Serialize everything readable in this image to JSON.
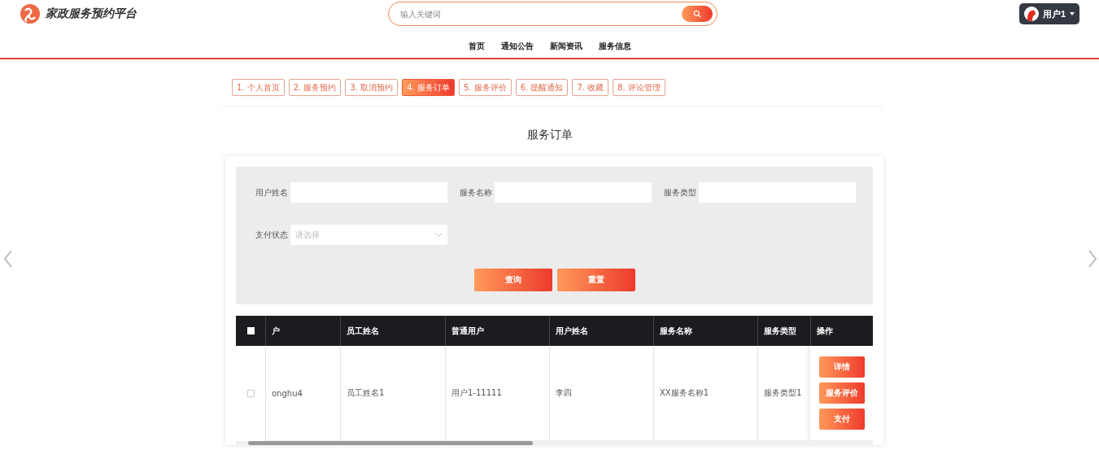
{
  "header": {
    "site_title": "家政服务预约平台",
    "search": {
      "placeholder": "输入关键词"
    },
    "user": {
      "name": "用户1"
    }
  },
  "nav": [
    {
      "label": "首页"
    },
    {
      "label": "通知公告"
    },
    {
      "label": "新闻资讯"
    },
    {
      "label": "服务信息"
    }
  ],
  "center_tabs": [
    {
      "label": "1. 个人首页",
      "selected": false
    },
    {
      "label": "2. 服务预约",
      "selected": false
    },
    {
      "label": "3. 取消预约",
      "selected": false
    },
    {
      "label": "4. 服务订单",
      "selected": true
    },
    {
      "label": "5. 服务评价",
      "selected": false
    },
    {
      "label": "6. 提醒通知",
      "selected": false
    },
    {
      "label": "7. 收藏",
      "selected": false
    },
    {
      "label": "8. 评论管理",
      "selected": false
    }
  ],
  "page_title": "服务订单",
  "filters": [
    {
      "label": "用户姓名",
      "kind": "text"
    },
    {
      "label": "服务名称",
      "kind": "text"
    },
    {
      "label": "服务类型",
      "kind": "text"
    },
    {
      "label": "支付状态",
      "kind": "select",
      "placeholder": "请选择"
    }
  ],
  "filter_buttons": [
    "查询",
    "重置"
  ],
  "table": {
    "select_all_checked": false,
    "columns": [
      "户",
      "员工姓名",
      "普通用户",
      "用户姓名",
      "服务名称",
      "服务类型",
      "操作"
    ],
    "rows": [
      {
        "checked": false,
        "cells": [
          "onghu4",
          "员工姓名1",
          "用户1-11111",
          "李四",
          "XX服务名称1",
          "服务类型1"
        ],
        "actions": [
          "详情",
          "服务评价",
          "支付"
        ]
      }
    ]
  }
}
